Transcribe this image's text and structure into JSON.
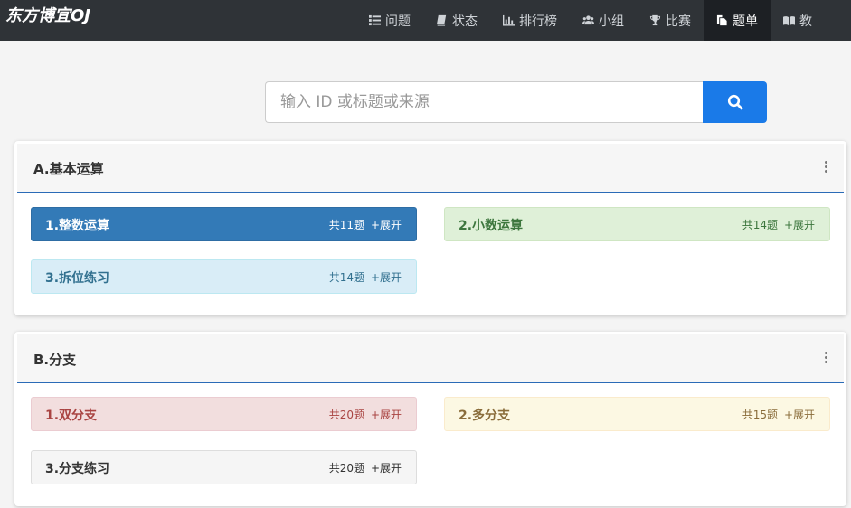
{
  "brand": "东方博宜OJ",
  "nav": [
    {
      "label": "问题",
      "icon": "list-icon"
    },
    {
      "label": "状态",
      "icon": "book-icon"
    },
    {
      "label": "排行榜",
      "icon": "bar-chart-icon"
    },
    {
      "label": "小组",
      "icon": "users-icon"
    },
    {
      "label": "比赛",
      "icon": "trophy-icon"
    },
    {
      "label": "题单",
      "icon": "copy-icon",
      "active": true
    },
    {
      "label": "教",
      "icon": "open-book-icon"
    }
  ],
  "search": {
    "placeholder": "输入 ID 或标题或来源",
    "value": ""
  },
  "groups": [
    {
      "title": "A.基本运算",
      "sets": [
        {
          "name": "1.整数运算",
          "count": "共11题",
          "expand": "+展开",
          "style": "primary"
        },
        {
          "name": "2.小数运算",
          "count": "共14题",
          "expand": "+展开",
          "style": "success"
        },
        {
          "name": "3.拆位练习",
          "count": "共14题",
          "expand": "+展开",
          "style": "info"
        }
      ]
    },
    {
      "title": "B.分支",
      "sets": [
        {
          "name": "1.双分支",
          "count": "共20题",
          "expand": "+展开",
          "style": "danger"
        },
        {
          "name": "2.多分支",
          "count": "共15题",
          "expand": "+展开",
          "style": "warning"
        },
        {
          "name": "3.分支练习",
          "count": "共20题",
          "expand": "+展开",
          "style": "default"
        }
      ]
    }
  ],
  "colors": {
    "navbar": "#2f3337",
    "search_button": "#1a7ae8",
    "panel_rule": "#2a6bb7"
  }
}
